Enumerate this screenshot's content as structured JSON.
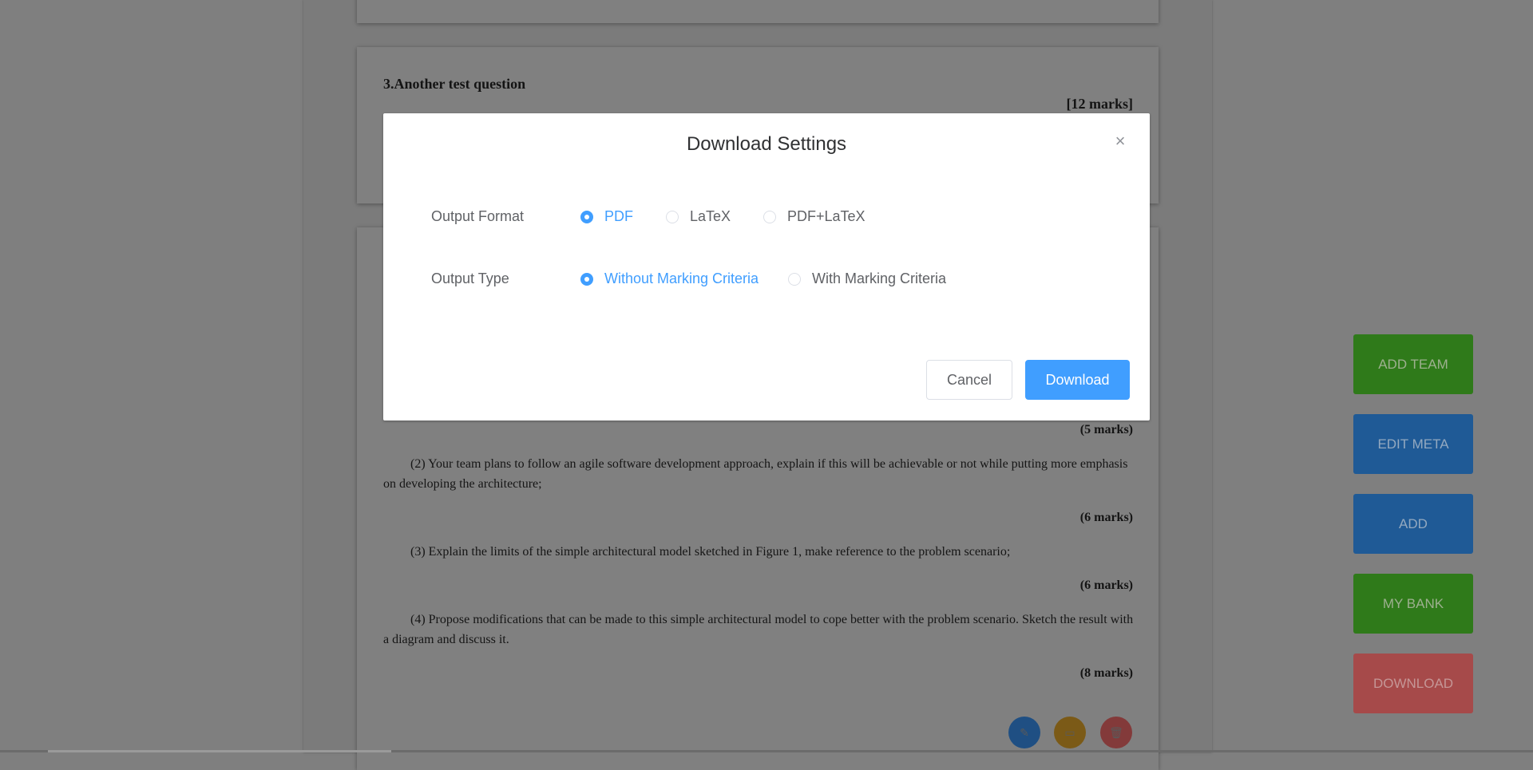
{
  "background": {
    "question3": {
      "title": "3.Another test question",
      "marks": "[12 marks]"
    },
    "question4": {
      "sub_marks": [
        "(5 marks)",
        "(6 marks)",
        "(6 marks)",
        "(8 marks)"
      ],
      "paragraphs": [
        "(2) Your team plans to follow an agile software development approach, explain if this will be achievable or not while putting more emphasis on developing the architecture;",
        "(3) Explain the limits of the simple architectural model sketched in Figure 1, make reference to the problem scenario;",
        "(4) Propose modifications that can be made to this simple architectural model to cope better with the problem scenario. Sketch the result with a diagram and discuss it."
      ]
    },
    "card_actions": {
      "edit_icon": "pencil-icon",
      "comment_icon": "comment-icon",
      "delete_icon": "trash-icon",
      "edit_glyph": "✎",
      "comment_glyph": "▭",
      "delete_glyph": "🗑"
    },
    "side_buttons": {
      "add_team": "ADD TEAM",
      "edit_meta": "EDIT META",
      "add": "ADD",
      "my_bank": "MY BANK",
      "download": "DOWNLOAD"
    }
  },
  "modal": {
    "title": "Download Settings",
    "close_glyph": "×",
    "output_format": {
      "label": "Output Format",
      "options": [
        "PDF",
        "LaTeX",
        "PDF+LaTeX"
      ],
      "selected": "PDF"
    },
    "output_type": {
      "label": "Output Type",
      "options": [
        "Without Marking Criteria",
        "With Marking Criteria"
      ],
      "selected": "Without Marking Criteria"
    },
    "cancel_label": "Cancel",
    "download_label": "Download"
  },
  "colors": {
    "primary": "#409eff",
    "overlay": "#7f7f7f"
  }
}
